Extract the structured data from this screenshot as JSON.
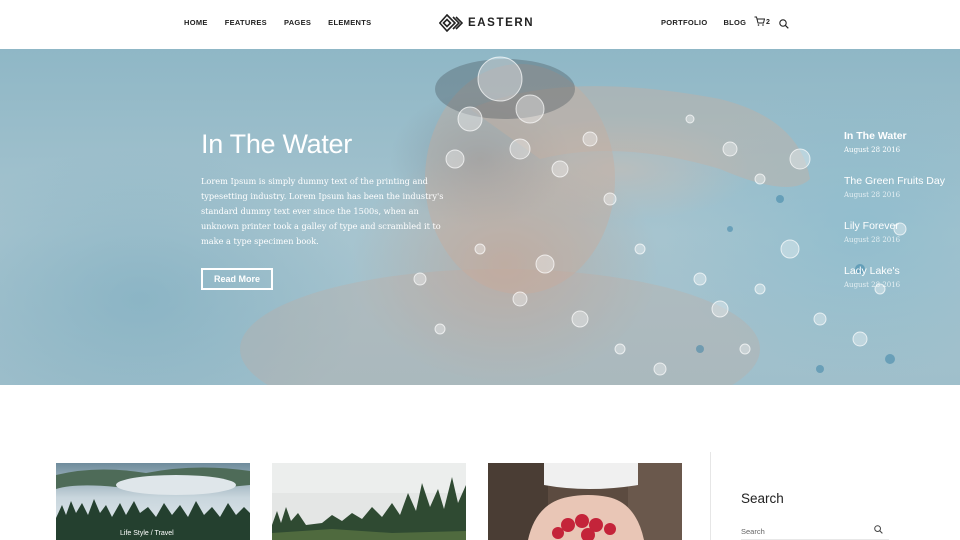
{
  "header": {
    "logo_text": "EASTERN",
    "nav_left": [
      "HOME",
      "FEATURES",
      "PAGES",
      "ELEMENTS"
    ],
    "nav_right": [
      "PORTFOLIO",
      "BLOG"
    ],
    "cart_count": "2",
    "icons": [
      "logo-diamond-icon",
      "cart-icon",
      "search-icon"
    ]
  },
  "hero": {
    "title": "In The Water",
    "text": "Lorem Ipsum is simply dummy text of the printing and typesetting industry. Lorem Ipsum has been the industry's standard dummy text ever since the 1500s, when an unknown printer took a galley of type and scrambled it to make a type specimen book.",
    "button_label": "Read More",
    "side_posts": [
      {
        "title": "In The Water",
        "date": "August 28 2016"
      },
      {
        "title": "The Green Fruits Day",
        "date": "August 28 2016"
      },
      {
        "title": "Lily Forever",
        "date": "August 28 2016"
      },
      {
        "title": "Lady Lake's",
        "date": "August 28 2016"
      }
    ]
  },
  "posts": [
    {
      "categories": "Life Style  /  Travel",
      "image": "misty-forest"
    },
    {
      "categories": "",
      "image": "pine-forest"
    },
    {
      "categories": "",
      "image": "hands-raspberries"
    }
  ],
  "sidebar": {
    "widget_title": "Search",
    "search_placeholder": "Search"
  },
  "colors": {
    "text": "#222222",
    "hero_tint": "#9fbfcb",
    "white": "#ffffff"
  }
}
